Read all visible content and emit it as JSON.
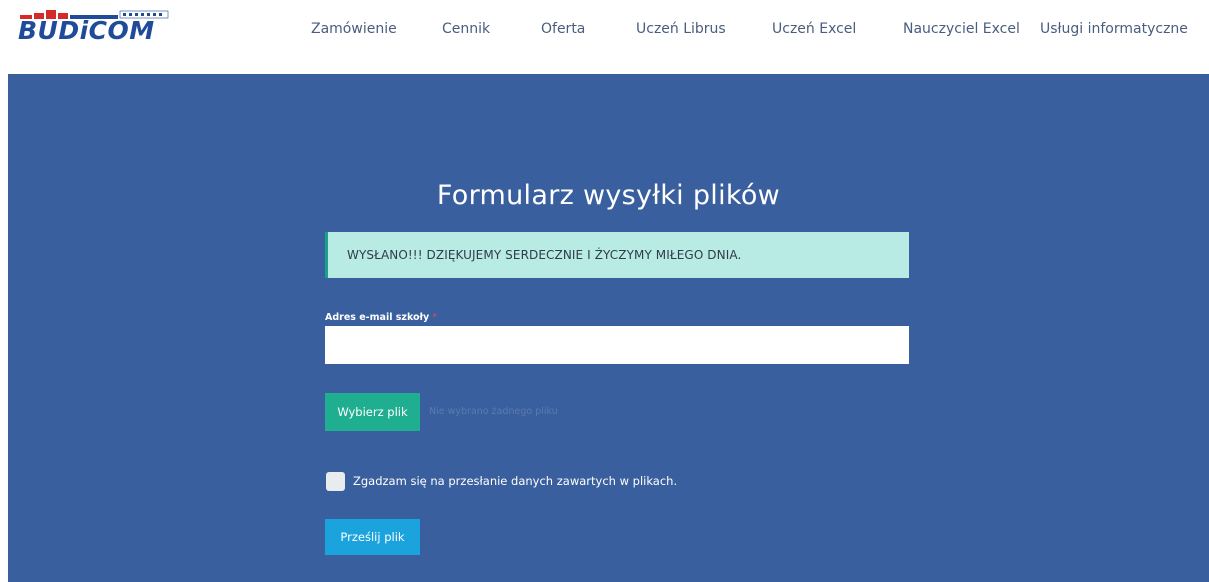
{
  "header": {
    "logo_text": "BUDiCOM",
    "brand_color": "#1f4b9a",
    "logo_accent_color": "#d42a2a",
    "nav": [
      {
        "label": "Zamówienie"
      },
      {
        "label": "Cennik"
      },
      {
        "label": "Oferta"
      },
      {
        "label": "Uczeń Librus"
      },
      {
        "label": "Uczeń Excel"
      },
      {
        "label": "Nauczyciel Excel"
      },
      {
        "label": "Usługi informatyczne"
      }
    ]
  },
  "form": {
    "title": "Formularz wysyłki plików",
    "success_message": "WYSŁANO!!! DZIĘKUJEMY SERDECZNIE I ŻYCZYMY MIŁEGO DNIA.",
    "email_label": "Adres e-mail szkoły",
    "required_mark": "*",
    "email_value": "",
    "file_button_label": "Wybierz plik",
    "file_status": "Nie wybrano żadnego pliku",
    "consent_checked": false,
    "consent_label": "Zgadzam się na przesłanie danych zawartych w plikach.",
    "submit_label": "Prześlij plik"
  },
  "colors": {
    "hero_background": "#3a5f9e",
    "alert_background": "#b8ebe3",
    "alert_border": "#1aa18a",
    "file_button": "#1fae8f",
    "submit_button": "#1aa3dc",
    "required": "#e0485a"
  }
}
